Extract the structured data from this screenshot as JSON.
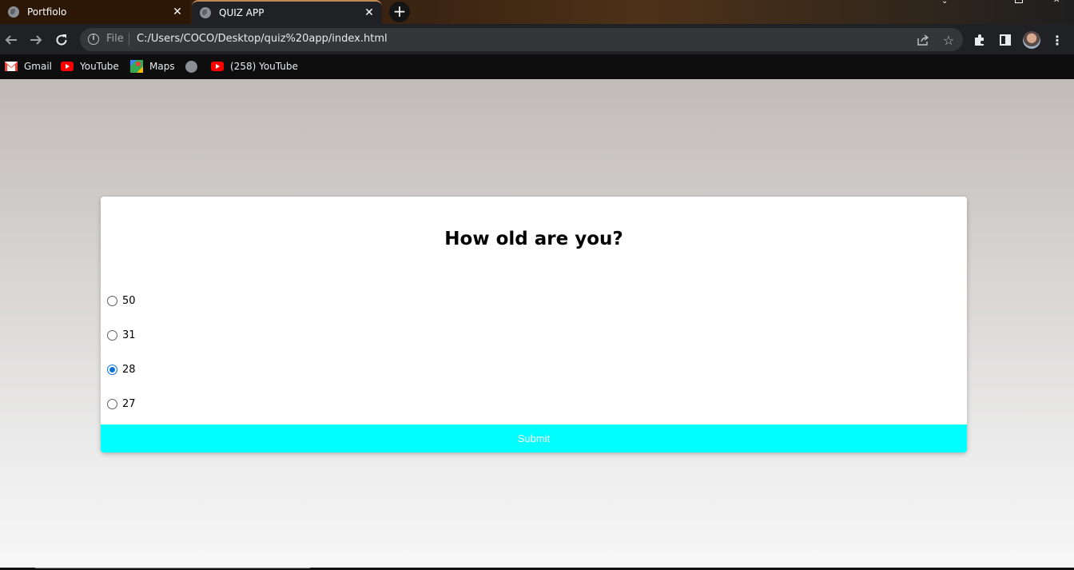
{
  "tabs": [
    {
      "title": "Portfiolo",
      "icon": "globe-icon"
    },
    {
      "title": "QUIZ APP",
      "icon": "globe-icon",
      "active": true
    }
  ],
  "omnibox": {
    "scheme_label": "File",
    "url": "C:/Users/COCO/Desktop/quiz%20app/index.html"
  },
  "bookmarks": [
    {
      "label": "Gmail",
      "icon": "gmail-icon"
    },
    {
      "label": "YouTube",
      "icon": "youtube-icon"
    },
    {
      "label": "Maps",
      "icon": "maps-icon"
    },
    {
      "label": "",
      "icon": "globe-icon"
    },
    {
      "label": "(258) YouTube",
      "icon": "youtube-icon"
    }
  ],
  "quiz": {
    "question": "How old are you?",
    "answers": [
      {
        "label": "50",
        "checked": false
      },
      {
        "label": "31",
        "checked": false
      },
      {
        "label": "28",
        "checked": true
      },
      {
        "label": "27",
        "checked": false
      }
    ],
    "submit_label": "Submit",
    "submit_color": "#00ffff"
  },
  "colors": {
    "radio_checked": "#0b73d6",
    "tab_accent": "#c08a55"
  }
}
